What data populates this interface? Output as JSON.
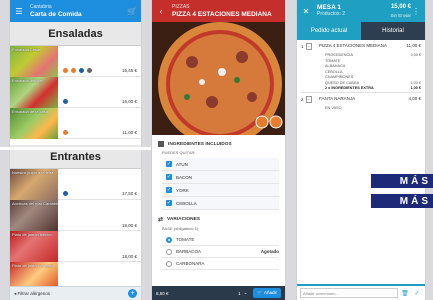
{
  "phone1": {
    "header": {
      "small": "Cantabria",
      "title": "Carta de Comida"
    },
    "panels": [
      {
        "category": "Ensaladas",
        "products": [
          {
            "name": "Ensalada César",
            "price": "16,45 €"
          },
          {
            "name": "Ensalada Ibérica",
            "price": "16,00 €"
          },
          {
            "name": "Ensalada de la casa",
            "price": "11,00 €"
          }
        ]
      },
      {
        "category": "Entrantes",
        "products": [
          {
            "name": "Nuestro pulpo a la feira",
            "price": "17,50 €"
          },
          {
            "name": "Anchoas del mar Cantábrico",
            "price": "18,00 €"
          },
          {
            "name": "Plato de jamón ibérico",
            "price": "18,00 €"
          },
          {
            "name": "Plato de jamón y queso",
            "price": ""
          }
        ]
      }
    ],
    "footer": {
      "label": "Filtrar alérgenos",
      "plus": "+"
    }
  },
  "phone2": {
    "header": {
      "small": "PIZZAS",
      "title": "PIZZA 4 ESTACIONES MEDIANA"
    },
    "ingredients_title": "INGREDIENTES INCLUIDOS",
    "ingredients_hint": "PUEDES QUITAR:",
    "ingredients": [
      "ATUN",
      "BACON",
      "YORK",
      "CEBOLLA"
    ],
    "variations_title": "VARIACIONES",
    "variations_hint": "BASE (obligatorio 1)",
    "variations": [
      {
        "name": "TOMATE",
        "extra": "",
        "selected": true
      },
      {
        "name": "BARBACOA",
        "extra": "Agotado",
        "selected": false
      },
      {
        "name": "CARBONARA",
        "extra": "",
        "selected": false
      }
    ],
    "bottom": {
      "price": "8,50 €",
      "qty": "1",
      "add": "Añadir"
    }
  },
  "phone3": {
    "header": {
      "small": "Productos: 2",
      "title": "MESA 1",
      "total": "15,00 €",
      "total_small": "Sin Enviar"
    },
    "tabs": [
      "Pedido actual",
      "Historial"
    ],
    "lines": [
      {
        "qty": "1",
        "name": "PIZZA 4 ESTACIONES MEDIANA",
        "price": "11,00 €",
        "details": [
          {
            "text": "PROCEDENCIA",
            "price": "3,00 €"
          },
          {
            "text": "TOMATE",
            "price": ""
          },
          {
            "text": "ALBAHACA",
            "price": ""
          },
          {
            "text": "CEBOLLA",
            "price": ""
          },
          {
            "text": "CHAMPIÑONES",
            "price": ""
          },
          {
            "text": "QUESO DE CABRA",
            "price": "1,00 €"
          },
          {
            "text": "2 x INGREDIENTES EXTRA",
            "price": "1,00 €"
          }
        ]
      },
      {
        "qty": "2",
        "name": "FANTA NARANJA",
        "price": "4,00 €",
        "details": [
          {
            "text": "EN VASO",
            "price": ""
          }
        ]
      }
    ],
    "input_placeholder": "Añadir comentario..."
  },
  "banners": [
    "MÁS",
    "MÁS"
  ],
  "colors": {
    "blue": "#1e8fde",
    "red": "#c42f2c",
    "teal": "#1f9fc1",
    "navy": "#1d2a78"
  }
}
